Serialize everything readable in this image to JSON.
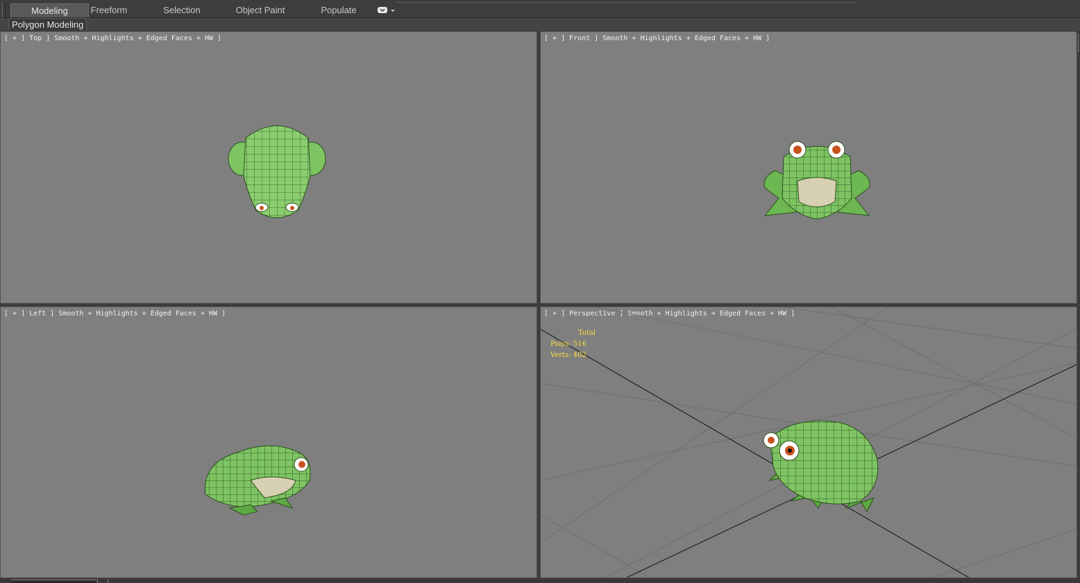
{
  "ribbon": {
    "tabs": [
      {
        "label": "Modeling",
        "active": true
      },
      {
        "label": "Freeform",
        "active": false
      },
      {
        "label": "Selection",
        "active": false
      },
      {
        "label": "Object Paint",
        "active": false
      },
      {
        "label": "Populate",
        "active": false
      }
    ],
    "panel_label": "Polygon Modeling"
  },
  "viewports": [
    {
      "id": "top",
      "label": "[ + ] Top ] Smooth + Highlights + Edged Faces + HW ]"
    },
    {
      "id": "front",
      "label": "[ + ] Front ] Smooth + Highlights + Edged Faces + HW ]"
    },
    {
      "id": "left",
      "label": "[ + ] Left ] Smooth + Highlights + Edged Faces + HW ]"
    },
    {
      "id": "perspective",
      "label": "[ + ] Perspective ] Smooth + Highlights + Edged Faces + HW ]"
    }
  ],
  "stats": {
    "title": "Total",
    "polys_label": "Polys:",
    "polys": "516",
    "verts_label": "Verts:",
    "verts": "402"
  },
  "colors": {
    "viewport_bg": "#7f7f7f",
    "frog_green": "#7ec463",
    "frog_dark_green": "#3e7a2a",
    "frog_belly": "#d7d0b2",
    "eye_orange": "#c8521e",
    "stats_yellow": "#ffde3a"
  }
}
